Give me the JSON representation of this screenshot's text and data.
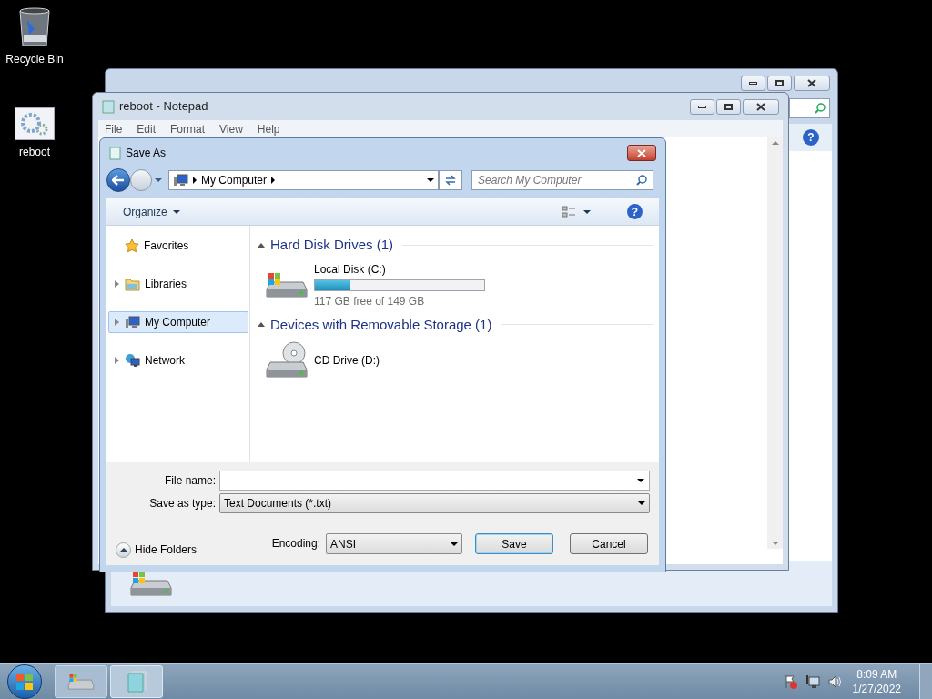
{
  "explorer": {
    "help_glyph": "?"
  },
  "desktop_icons": [
    {
      "label": "Recycle Bin",
      "kind": "bin"
    },
    {
      "label": "reboot",
      "kind": "script"
    }
  ],
  "notepad": {
    "title": "reboot - Notepad",
    "menu": [
      "File",
      "Edit",
      "Format",
      "View",
      "Help"
    ]
  },
  "save_as": {
    "title": "Save As",
    "breadcrumb": [
      "My Computer"
    ],
    "search": {
      "placeholder": "Search My Computer"
    },
    "organize": "Organize",
    "help_glyph": "?",
    "nav": [
      {
        "label": "Favorites",
        "kind": "star",
        "expandable": false,
        "selected": false
      },
      {
        "label": "Libraries",
        "kind": "folder",
        "expandable": true,
        "selected": false
      },
      {
        "label": "My Computer",
        "kind": "computer",
        "expandable": true,
        "selected": true
      },
      {
        "label": "Network",
        "kind": "network",
        "expandable": true,
        "selected": false
      }
    ],
    "groups": [
      {
        "title": "Hard Disk Drives (1)",
        "items": [
          {
            "name": "Local Disk (C:)",
            "kind": "disk",
            "level": 0.21,
            "detail": "117 GB free of 149 GB"
          }
        ]
      },
      {
        "title": "Devices with Removable Storage (1)",
        "items": [
          {
            "name": "CD Drive (D:)",
            "kind": "cd"
          }
        ]
      }
    ],
    "file_name_label": "File name:",
    "type_label": "Save as type:",
    "type_value": "Text Documents (*.txt)",
    "hide_folders": "Hide Folders",
    "encoding_label": "Encoding:",
    "encoding": "ANSI",
    "buttons": [
      "Save",
      "Cancel"
    ]
  },
  "taskbar": {
    "time": "8:09 AM",
    "date": "1/27/2022"
  }
}
